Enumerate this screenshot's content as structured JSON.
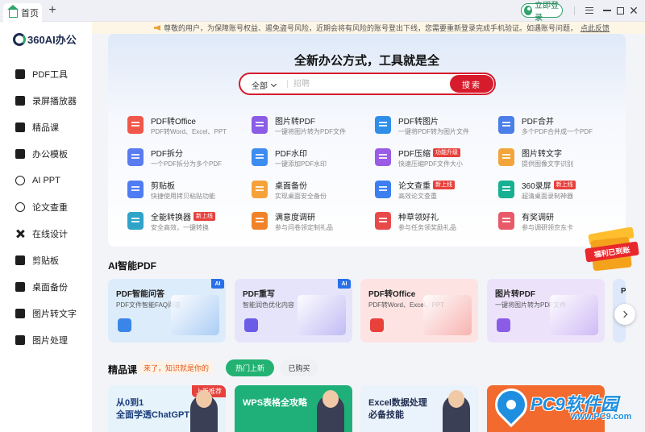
{
  "titlebar": {
    "tab_label": "首页",
    "new_tab": "+",
    "login_label": "立即登录"
  },
  "sidebar": {
    "logo": "360AI办公",
    "items": [
      {
        "label": "PDF工具",
        "icon": "pdf-icon"
      },
      {
        "label": "录屏播放器",
        "icon": "record-icon"
      },
      {
        "label": "精品课",
        "icon": "course-icon"
      },
      {
        "label": "办公模板",
        "icon": "template-icon"
      },
      {
        "label": "AI PPT",
        "icon": "ppt-icon"
      },
      {
        "label": "论文查重",
        "icon": "paper-check-icon"
      },
      {
        "label": "在线设计",
        "icon": "design-icon"
      },
      {
        "label": "剪贴板",
        "icon": "clipboard-icon"
      },
      {
        "label": "桌面备份",
        "icon": "backup-icon"
      },
      {
        "label": "图片转文字",
        "icon": "ocr-icon"
      },
      {
        "label": "图片处理",
        "icon": "image-edit-icon"
      }
    ]
  },
  "notice": {
    "text": "尊敬的用户，为保障账号权益、遏免盗号风险，近期会将有风险的账号登出下线，您需要重新登录完成手机验证。如遇账号问题，",
    "link": "点此反馈"
  },
  "hero": {
    "title": "全新办公方式，工具就是全",
    "search_scope": "全部",
    "search_placeholder": "招聘",
    "search_button": "搜索"
  },
  "tools": [
    {
      "name": "PDF转Office",
      "desc": "PDF转Word、Excel、PPT",
      "tag": "",
      "color": "#f0574a"
    },
    {
      "name": "图片转PDF",
      "desc": "一键将图片转为PDF文件",
      "tag": "",
      "color": "#8b5ce6"
    },
    {
      "name": "PDF转图片",
      "desc": "一键将PDF转为图片文件",
      "tag": "",
      "color": "#2f8fe8"
    },
    {
      "name": "PDF合并",
      "desc": "多个PDF合并成一个PDF",
      "tag": "",
      "color": "#4a7ee8"
    },
    {
      "name": "PDF拆分",
      "desc": "一个PDF拆分为多个PDF",
      "tag": "",
      "color": "#5b7cf0"
    },
    {
      "name": "PDF水印",
      "desc": "一键添加PDF水印",
      "tag": "",
      "color": "#3d8cf0"
    },
    {
      "name": "PDF压缩",
      "desc": "快速压缩PDF文件大小",
      "tag": "功能升级",
      "color": "#9a5ce6"
    },
    {
      "name": "图片转文字",
      "desc": "提供图像文字识别",
      "tag": "",
      "color": "#f2a53a"
    },
    {
      "name": "剪贴板",
      "desc": "快捷使用拷贝粘贴功能",
      "tag": "",
      "color": "#4f7cf2"
    },
    {
      "name": "桌面备份",
      "desc": "实现桌面安全备份",
      "tag": "",
      "color": "#f5a23a"
    },
    {
      "name": "论文查重",
      "desc": "高效论文查重",
      "tag": "新上线",
      "color": "#3b7ff0"
    },
    {
      "name": "360录屏",
      "desc": "超清桌面录制神器",
      "tag": "新上线",
      "color": "#18b092"
    },
    {
      "name": "全能转换器",
      "desc": "安全高效，一键转换",
      "tag": "新上线",
      "color": "#2fa3c8"
    },
    {
      "name": "满意度调研",
      "desc": "参与问卷领定制礼品",
      "tag": "",
      "color": "#f0822a"
    },
    {
      "name": "种草领好礼",
      "desc": "参与任务领奖励礼品",
      "tag": "",
      "color": "#e8494a"
    },
    {
      "name": "有奖调研",
      "desc": "参与调研领京东卡",
      "tag": "",
      "color": "#e85a6a"
    }
  ],
  "ai_section": {
    "title": "AI智能PDF",
    "cards": [
      {
        "title": "PDF智能问答",
        "desc": "PDF文件智能FAQ问答",
        "badge": "AI",
        "bg": "#dcecfb",
        "accent": "#3a86e8"
      },
      {
        "title": "PDF重写",
        "desc": "智能润色优化内容",
        "badge": "AI",
        "bg": "#e6e4fa",
        "accent": "#6a5ce6"
      },
      {
        "title": "PDF转Office",
        "desc": "PDF转Word、Excel、PPT",
        "badge": "",
        "bg": "#fde4e3",
        "accent": "#e8413c"
      },
      {
        "title": "图片转PDF",
        "desc": "一键将图片转为PDF文件",
        "badge": "",
        "bg": "#ece3fb",
        "accent": "#8b5ce6"
      },
      {
        "title": "P",
        "desc": "",
        "badge": "",
        "bg": "#dde9fb",
        "accent": "#3a86e8"
      }
    ]
  },
  "course_section": {
    "title": "精品课",
    "slogan": "来了，知识就是你的",
    "tab_hot": "热门上新",
    "tab_bought": "已购买",
    "courses": [
      {
        "line1": "从0到1",
        "line2": "全面学透ChatGPT",
        "tag": "上新推荐",
        "bg": "#e7f3fb",
        "fg": "#1a3d7a"
      },
      {
        "line1": "WPS表格全攻略",
        "line2": "",
        "tag": "",
        "bg": "#1fb07a",
        "fg": "#ffffff"
      },
      {
        "line1": "Excel数据处理",
        "line2": "必备技能",
        "tag": "",
        "bg": "#eaf2fb",
        "fg": "#1d2b4f"
      },
      {
        "line1": "",
        "line2": "",
        "tag": "",
        "bg": "#f26a2e",
        "fg": "#ffffff"
      }
    ]
  },
  "promo": {
    "label": "福利已到账"
  },
  "watermark": {
    "brand": "PC9软件园",
    "url": "www.PC9.com"
  }
}
